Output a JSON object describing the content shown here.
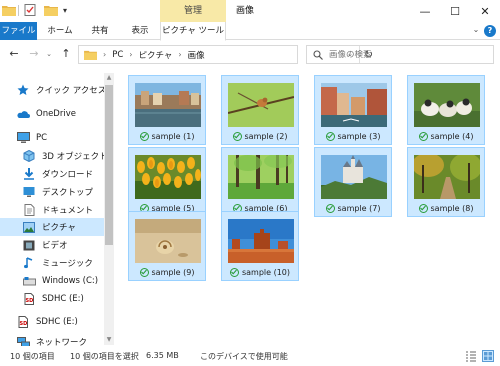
{
  "window": {
    "title": "画像",
    "context_tab_group": "管理",
    "minimize_glyph": "—",
    "maximize_glyph": "☐",
    "close_glyph": "✕"
  },
  "ribbon": {
    "tabs": [
      {
        "label": "ファイル"
      },
      {
        "label": "ホーム"
      },
      {
        "label": "共有"
      },
      {
        "label": "表示"
      },
      {
        "label": "ピクチャ ツール"
      }
    ],
    "help_glyph": "?"
  },
  "nav": {
    "breadcrumbs": [
      "PC",
      "ピクチャ",
      "画像"
    ],
    "search_placeholder": "画像の検索"
  },
  "sidebar": {
    "items": [
      {
        "label": "クイック アクセス",
        "icon": "star-icon"
      },
      {
        "label": "OneDrive",
        "icon": "cloud-icon"
      },
      {
        "label": "PC",
        "icon": "computer-icon"
      },
      {
        "label": "3D オブジェクト",
        "icon": "cube-icon"
      },
      {
        "label": "ダウンロード",
        "icon": "download-icon"
      },
      {
        "label": "デスクトップ",
        "icon": "desktop-icon"
      },
      {
        "label": "ドキュメント",
        "icon": "document-icon"
      },
      {
        "label": "ピクチャ",
        "icon": "pictures-icon",
        "selected": true
      },
      {
        "label": "ビデオ",
        "icon": "video-icon"
      },
      {
        "label": "ミュージック",
        "icon": "music-icon"
      },
      {
        "label": "Windows (C:)",
        "icon": "drive-icon"
      },
      {
        "label": "SDHC (E:)",
        "icon": "sd-card-icon"
      },
      {
        "label": "SDHC (E:)",
        "icon": "sd-card-icon"
      },
      {
        "label": "ネットワーク",
        "icon": "network-icon"
      }
    ]
  },
  "files": [
    {
      "name": "sample (1)",
      "thumbnail": "canal-town"
    },
    {
      "name": "sample (2)",
      "thumbnail": "bird-on-branch"
    },
    {
      "name": "sample (3)",
      "thumbnail": "venice-canal"
    },
    {
      "name": "sample (4)",
      "thumbnail": "ducklings"
    },
    {
      "name": "sample (5)",
      "thumbnail": "tulips"
    },
    {
      "name": "sample (6)",
      "thumbnail": "green-forest"
    },
    {
      "name": "sample (7)",
      "thumbnail": "castle"
    },
    {
      "name": "sample (8)",
      "thumbnail": "autumn-path"
    },
    {
      "name": "sample (9)",
      "thumbnail": "sand-shell"
    },
    {
      "name": "sample (10)",
      "thumbnail": "desert-monument"
    }
  ],
  "status": {
    "item_count": "10 個の項目",
    "selected": "10 個の項目を選択",
    "size": "6.35 MB",
    "availability": "このデバイスで使用可能"
  },
  "colors": {
    "accent": "#1979ca",
    "selection": "#cce8ff",
    "selection_border": "#99d1ff",
    "context_tab": "#f8e9a7"
  }
}
